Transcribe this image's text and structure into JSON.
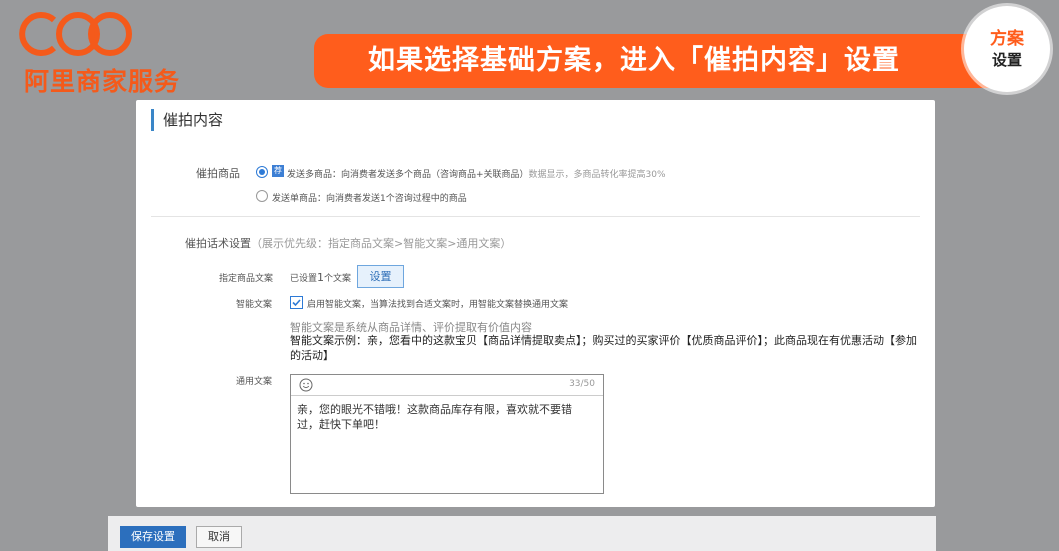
{
  "brand": {
    "name": "阿里商家服务"
  },
  "banner": {
    "title": "如果选择基础方案，进入「催拍内容」设置"
  },
  "badge": {
    "line1": "方案",
    "line2": "设置"
  },
  "section": {
    "title": "催拍内容"
  },
  "products": {
    "label": "催拍商品",
    "option1": {
      "tag": "荐",
      "text": "发送多商品：向消费者发送多个商品（咨询商品+关联商品）",
      "note": "数据显示，多商品转化率提高30%",
      "checked": true
    },
    "option2": {
      "text": "发送单商品：向消费者发送1个咨询过程中的商品",
      "checked": false
    }
  },
  "script": {
    "label": "催拍话术设置",
    "priority": "（展示优先级：指定商品文案>智能文案>通用文案）",
    "specified": {
      "label": "指定商品文案",
      "status_prefix": "已设置",
      "count": "1",
      "status_suffix": "个文案",
      "button": "设置"
    },
    "smart": {
      "label": "智能文案",
      "checkbox_text": "启用智能文案，当算法找到合适文案时，用智能文案替换通用文案",
      "checked": true,
      "desc": "智能文案是系统从商品详情、评价提取有价值内容",
      "example": "智能文案示例：亲，您看中的这款宝贝【商品详情提取卖点】；购买过的买家评价【优质商品评价】；此商品现在有优惠活动【参加的活动】"
    },
    "generic": {
      "label": "通用文案",
      "counter": "33/50",
      "text": "亲，您的眼光不错哦！这款商品库存有限，喜欢就不要错过，赶快下单吧！"
    }
  },
  "footer": {
    "save": "保存设置",
    "cancel": "取消"
  },
  "icons": {
    "emoji": "smiley-icon",
    "brand": "brand-logo-icon"
  },
  "colors": {
    "accent": "#ff5d1c",
    "primary": "#2c6fbd"
  }
}
